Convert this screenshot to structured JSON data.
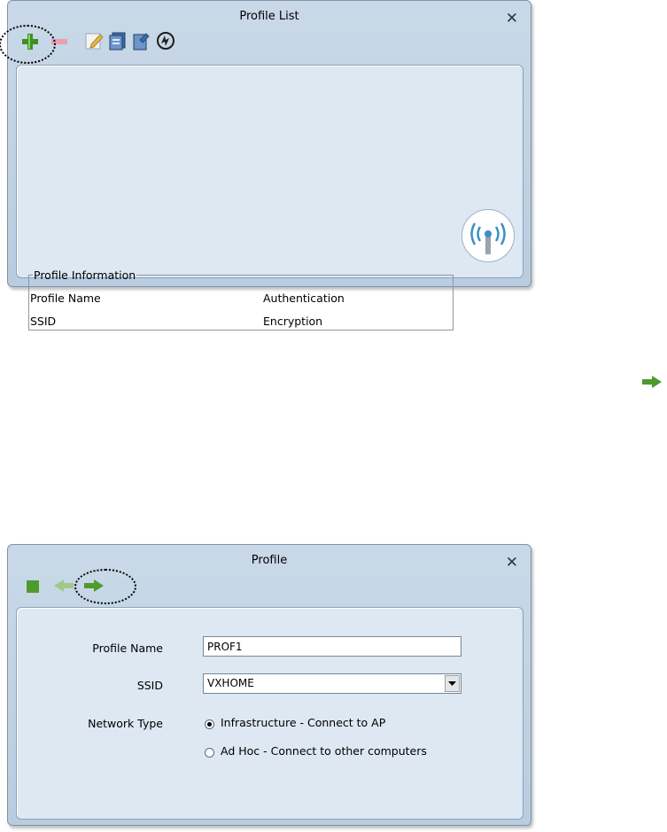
{
  "profile_list": {
    "title": "Profile List",
    "close_symbol": "✕",
    "toolbar": [
      {
        "name": "add-profile-icon"
      },
      {
        "name": "remove-profile-icon"
      },
      {
        "name": "edit-profile-icon"
      },
      {
        "name": "duplicate-profile-icon"
      },
      {
        "name": "activate-profile-icon"
      },
      {
        "name": "rescan-icon"
      }
    ],
    "profile_info": {
      "legend": "Profile Information",
      "profile_name_label": "Profile Name",
      "ssid_label": "SSID",
      "authentication_label": "Authentication",
      "encryption_label": "Encryption"
    },
    "antenna_icon": "wireless-antenna-icon"
  },
  "profile": {
    "title": "Profile",
    "close_symbol": "✕",
    "toolbar": [
      {
        "name": "stop-icon"
      },
      {
        "name": "back-arrow-icon"
      },
      {
        "name": "next-arrow-icon"
      }
    ],
    "profile_name_label": "Profile Name",
    "profile_name_value": "PROF1",
    "ssid_label": "SSID",
    "ssid_value": "VXHOME",
    "network_type_label": "Network Type",
    "network_options": [
      {
        "label": "Infrastructure - Connect to AP",
        "checked": true
      },
      {
        "label": "Ad Hoc - Connect to other computers",
        "checked": false
      }
    ]
  },
  "colors": {
    "window_bg": "#c4d5e6",
    "panel_bg": "#dde8f2",
    "green_icon": "#4f9a2e",
    "red_icon": "#e58aa0"
  }
}
